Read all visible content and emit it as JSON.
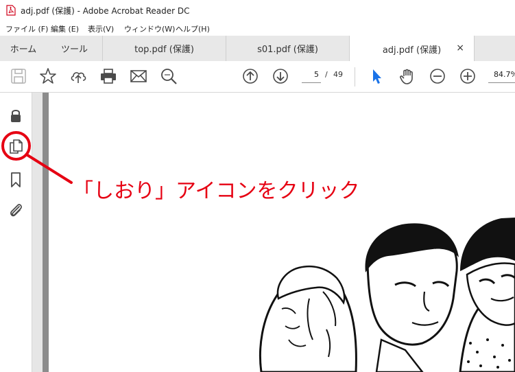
{
  "window": {
    "title": "adj.pdf (保護) - Adobe Acrobat Reader DC"
  },
  "menu": {
    "items": [
      "ファイル (F)",
      "編集 (E)",
      "表示(V)",
      "ウィンドウ(W)",
      "ヘルプ(H)"
    ]
  },
  "tabs": {
    "home": "ホーム",
    "tools": "ツール",
    "docs": [
      "top.pdf (保護)",
      "s01.pdf (保護)",
      "adj.pdf (保護)"
    ],
    "close_glyph": "×"
  },
  "toolbar": {
    "current_page": "5",
    "page_separator": "/",
    "total_pages": "49",
    "zoom": "84.7%",
    "accent_color": "#1a73e8"
  },
  "leftrail": {
    "icons": [
      "lock-icon",
      "pages-icon",
      "bookmark-icon",
      "attachment-icon"
    ]
  },
  "annotation": {
    "text": "「しおり」アイコンをクリック",
    "color": "#e60012"
  }
}
